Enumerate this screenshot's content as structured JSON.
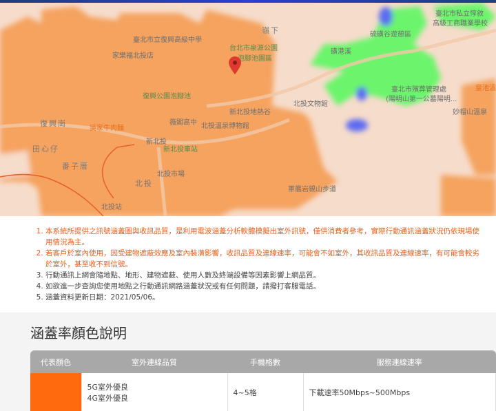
{
  "map": {
    "labels": [
      {
        "text": "臺北市立復興高級中學",
        "style": "",
        "pos": "a1"
      },
      {
        "text": "家樂福北投店",
        "style": "",
        "pos": "a2"
      },
      {
        "text": "台北市泉源公園",
        "style": "g",
        "pos": "a3"
      },
      {
        "text": "泡腳池園區",
        "style": "g",
        "pos": "a4"
      },
      {
        "text": "嶺下",
        "style": "b",
        "pos": "a5"
      },
      {
        "text": "硫磺谷遊憩區",
        "style": "",
        "pos": "a6"
      },
      {
        "text": "磺港溪",
        "style": "",
        "pos": "a7"
      },
      {
        "text": "臺北市私立惇敘",
        "style": "",
        "pos": "a8"
      },
      {
        "text": "高級工商職業學校",
        "style": "",
        "pos": "a9"
      },
      {
        "text": "臺北市殯葬管理處",
        "style": "",
        "pos": "a10"
      },
      {
        "text": "(陽明山第一公墓陽明...",
        "style": "",
        "pos": "a11"
      },
      {
        "text": "皇池溫",
        "style": "o",
        "pos": "a12"
      },
      {
        "text": "北投文物館",
        "style": "",
        "pos": "a13"
      },
      {
        "text": "妙帽山溫泉",
        "style": "",
        "pos": "a14"
      },
      {
        "text": "復興公園泡腳池",
        "style": "g",
        "pos": "a15"
      },
      {
        "text": "新北投地熱谷",
        "style": "",
        "pos": "a16"
      },
      {
        "text": "薇閣高中",
        "style": "",
        "pos": "a17"
      },
      {
        "text": "北投溫泉博物館",
        "style": "",
        "pos": "a18"
      },
      {
        "text": "復興崗",
        "style": "b",
        "pos": "a19"
      },
      {
        "text": "吳家牛肉麵",
        "style": "o",
        "pos": "a20"
      },
      {
        "text": "田心仔",
        "style": "b",
        "pos": "a21"
      },
      {
        "text": "新北投",
        "style": "",
        "pos": "a22"
      },
      {
        "text": "新北投車站",
        "style": "g",
        "pos": "a23"
      },
      {
        "text": "番子厝",
        "style": "b",
        "pos": "a24"
      },
      {
        "text": "北投市場",
        "style": "",
        "pos": "a25"
      },
      {
        "text": "北投",
        "style": "b",
        "pos": "a26"
      },
      {
        "text": "軍艦岩親山步道",
        "style": "",
        "pos": "a27"
      },
      {
        "text": "北投站",
        "style": "",
        "pos": "a28"
      }
    ],
    "coverage_colors": {
      "excellent": "#f5a35f",
      "good": "#6cf56c",
      "fair": "#5b6cf0"
    }
  },
  "notes": [
    "本系統所提供之訊號涵蓋圖與收訊品質，是利用電波涵蓋分析軟體模擬出室外訊號，僅供消費者參考，實際行動通訊涵蓋狀況仍依現場使用情況為主。",
    "若客戶於室內使用，因受建物遮蔽效應及室內裝潢影響，收訊品質及連線速率，可能會不如室外，其收訊品質及連線速率，有可能會較劣於室外，甚至收不到信號。",
    "行動通訊上網會隨地點、地形、建物遮蔽、使用人數及終端設備等因素影響上網品質。",
    "如欲進一步查詢您使用地點之行動通訊網路涵蓋狀況或有任何問題，請撥打客服電話。",
    "涵蓋資料更新日期：2021/05/06。"
  ],
  "legend": {
    "title": "涵蓋率顏色說明",
    "headers": [
      "代表顏色",
      "室外連線品質",
      "手機格數",
      "服務連線速率"
    ],
    "rows": [
      {
        "color": "#ff6a0e",
        "quality_5g": "5G室外優良",
        "quality_4g": "4G室外優良",
        "bars": "4~5格",
        "speed": "下載速率50Mbps~500Mbps"
      }
    ]
  }
}
